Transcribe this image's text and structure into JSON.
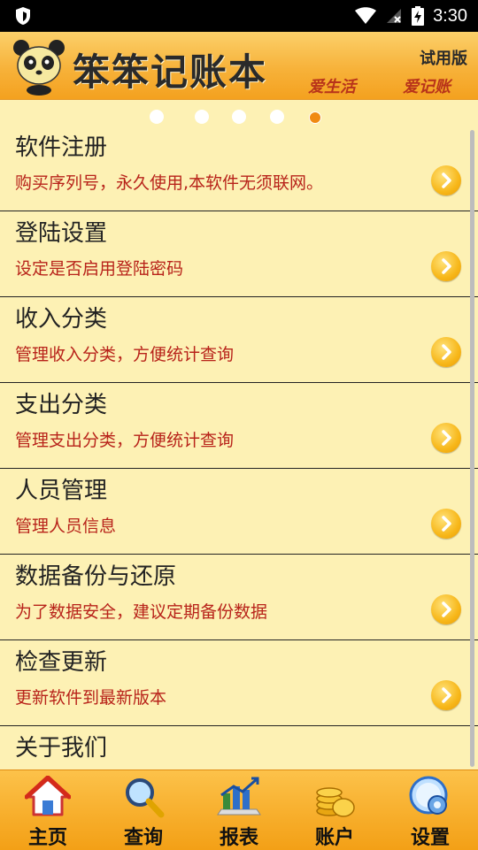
{
  "status_bar": {
    "time": "3:30"
  },
  "banner": {
    "title": "笨笨记账本",
    "edition": "试用版",
    "slogan_1": "爱生活",
    "slogan_2": "爱记账"
  },
  "pager": {
    "count": 5,
    "active_index": 4
  },
  "settings": {
    "items": [
      {
        "title": "软件注册",
        "desc": "购买序列号，永久使用,本软件无须联网。"
      },
      {
        "title": "登陆设置",
        "desc": "设定是否启用登陆密码"
      },
      {
        "title": "收入分类",
        "desc": "管理收入分类，方便统计查询"
      },
      {
        "title": "支出分类",
        "desc": "管理支出分类，方便统计查询"
      },
      {
        "title": "人员管理",
        "desc": "管理人员信息"
      },
      {
        "title": "数据备份与还原",
        "desc": "为了数据安全，建议定期备份数据"
      },
      {
        "title": "检查更新",
        "desc": "更新软件到最新版本"
      },
      {
        "title": "关于我们",
        "desc": ""
      }
    ]
  },
  "tabs": [
    {
      "label": "主页",
      "icon": "home-icon"
    },
    {
      "label": "查询",
      "icon": "magnifier-icon"
    },
    {
      "label": "报表",
      "icon": "bar-chart-icon"
    },
    {
      "label": "账户",
      "icon": "coins-icon"
    },
    {
      "label": "设置",
      "icon": "gear-icon"
    }
  ],
  "colors": {
    "accent": "#f7b23a",
    "desc_text": "#b8231a",
    "background": "#fdf1b4"
  }
}
